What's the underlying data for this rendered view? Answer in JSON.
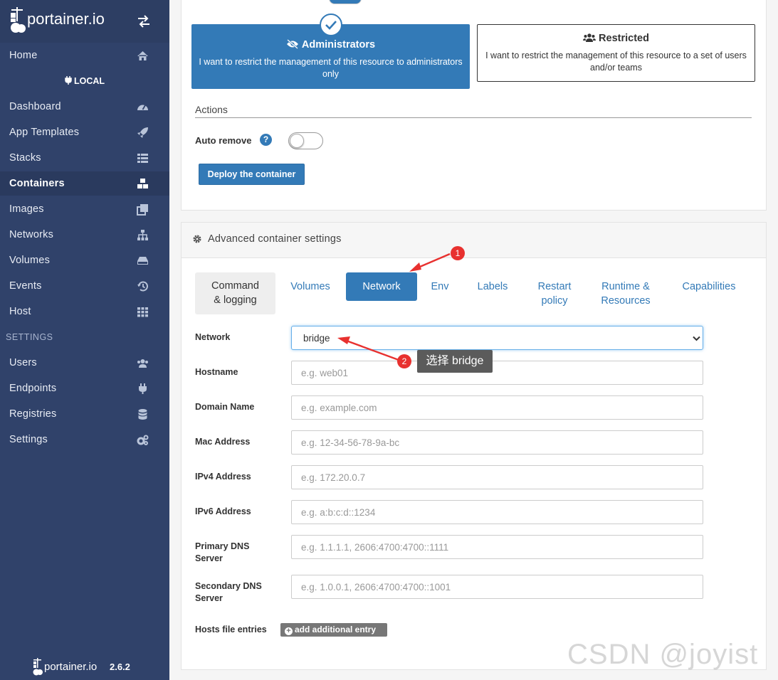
{
  "brand": {
    "name": "portainer.io",
    "version": "2.6.2"
  },
  "sidebar": {
    "home": "Home",
    "endpoint_header": "LOCAL",
    "items": [
      {
        "label": "Dashboard",
        "icon": "dashboard-icon"
      },
      {
        "label": "App Templates",
        "icon": "rocket-icon"
      },
      {
        "label": "Stacks",
        "icon": "list-icon"
      },
      {
        "label": "Containers",
        "icon": "cubes-icon",
        "active": true
      },
      {
        "label": "Images",
        "icon": "clone-icon"
      },
      {
        "label": "Networks",
        "icon": "sitemap-icon"
      },
      {
        "label": "Volumes",
        "icon": "hdd-icon"
      },
      {
        "label": "Events",
        "icon": "history-icon"
      },
      {
        "label": "Host",
        "icon": "th-icon"
      }
    ],
    "settings_header": "SETTINGS",
    "settings_items": [
      {
        "label": "Users",
        "icon": "users-icon"
      },
      {
        "label": "Endpoints",
        "icon": "plug-icon"
      },
      {
        "label": "Registries",
        "icon": "database-icon"
      },
      {
        "label": "Settings",
        "icon": "cogs-icon"
      }
    ]
  },
  "access_control": {
    "admin": {
      "title": "Administrators",
      "description": "I want to restrict the management of this resource to administrators only",
      "selected": true
    },
    "restricted": {
      "title": "Restricted",
      "description": "I want to restrict the management of this resource to a set of users and/or teams"
    }
  },
  "actions": {
    "title": "Actions",
    "auto_remove_label": "Auto remove",
    "auto_remove_enabled": false,
    "deploy_label": "Deploy the container"
  },
  "advanced": {
    "title": "Advanced container settings",
    "tabs": [
      {
        "label": "Command & logging"
      },
      {
        "label": "Volumes"
      },
      {
        "label": "Network",
        "active": true
      },
      {
        "label": "Env"
      },
      {
        "label": "Labels"
      },
      {
        "label": "Restart policy"
      },
      {
        "label": "Runtime & Resources"
      },
      {
        "label": "Capabilities"
      }
    ],
    "network": {
      "label": "Network",
      "value": "bridge"
    },
    "fields": {
      "hostname": {
        "label": "Hostname",
        "placeholder": "e.g. web01"
      },
      "domain": {
        "label": "Domain Name",
        "placeholder": "e.g. example.com"
      },
      "mac": {
        "label": "Mac Address",
        "placeholder": "e.g. 12-34-56-78-9a-bc"
      },
      "ipv4": {
        "label": "IPv4 Address",
        "placeholder": "e.g. 172.20.0.7"
      },
      "ipv6": {
        "label": "IPv6 Address",
        "placeholder": "e.g. a:b:c:d::1234"
      },
      "dns1": {
        "label": "Primary DNS Server",
        "placeholder": "e.g. 1.1.1.1, 2606:4700:4700::1111"
      },
      "dns2": {
        "label": "Secondary DNS Server",
        "placeholder": "e.g. 1.0.0.1, 2606:4700:4700::1001"
      }
    },
    "hosts_label": "Hosts file entries",
    "add_entry_label": "add additional entry"
  },
  "annotations": {
    "step1": "1",
    "step2": "2",
    "tooltip": "选择 bridge",
    "arrow_color": "#e8312f"
  },
  "watermark": "CSDN @joyist",
  "colors": {
    "sidebar_bg": "#30426a",
    "primary": "#337ab7",
    "annotation": "#e8312f"
  }
}
